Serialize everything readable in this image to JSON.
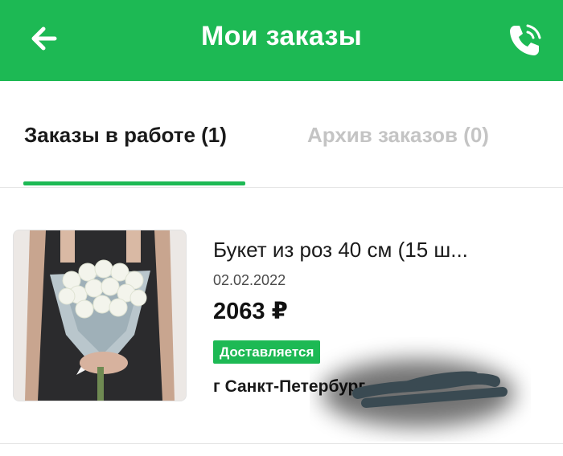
{
  "header": {
    "title": "Мои заказы",
    "back_icon": "arrow-left-icon",
    "call_icon": "phone-call-icon",
    "bg_color": "#1db954"
  },
  "tabs": [
    {
      "label": "Заказы в работе (1)",
      "active": true
    },
    {
      "label": "Архив заказов (0)",
      "active": false
    }
  ],
  "orders": [
    {
      "name": "Букет из роз 40 см (15 ш...",
      "date": "02.02.2022",
      "price": "2063 ₽",
      "status": "Доставляется",
      "address": "г Санкт-Петербург"
    }
  ],
  "colors": {
    "accent": "#1db954",
    "inactive_tab": "#c4c4c4",
    "text": "#1a1a1a"
  }
}
